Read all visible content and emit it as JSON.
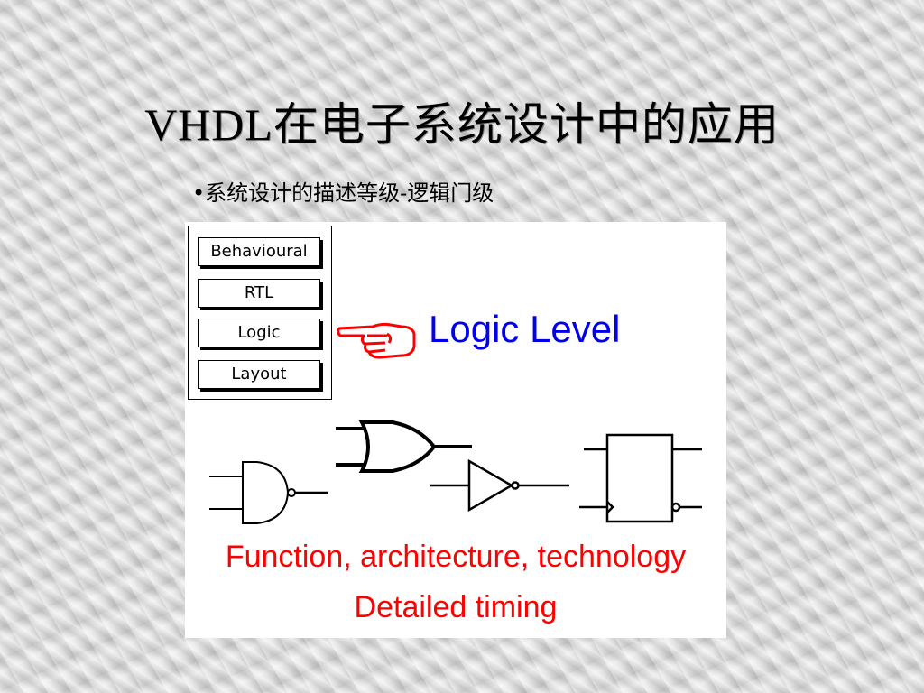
{
  "slide": {
    "title": "VHDL在电子系统设计中的应用",
    "bullet": "•系统设计的描述等级-逻辑门级"
  },
  "figure": {
    "levels": [
      {
        "label": "Behavioural"
      },
      {
        "label": "RTL"
      },
      {
        "label": "Logic"
      },
      {
        "label": "Layout"
      }
    ],
    "pointer_icon": "pointing-hand-icon",
    "current_level": "Logic Level",
    "gates": [
      "nand-gate",
      "or-gate",
      "inverter",
      "flip-flop"
    ],
    "captions": [
      "Function, architecture, technology",
      "Detailed timing"
    ],
    "colors": {
      "level_title": "#0000ee",
      "caption": "#ff0000",
      "pointer": "#ff0000"
    }
  }
}
